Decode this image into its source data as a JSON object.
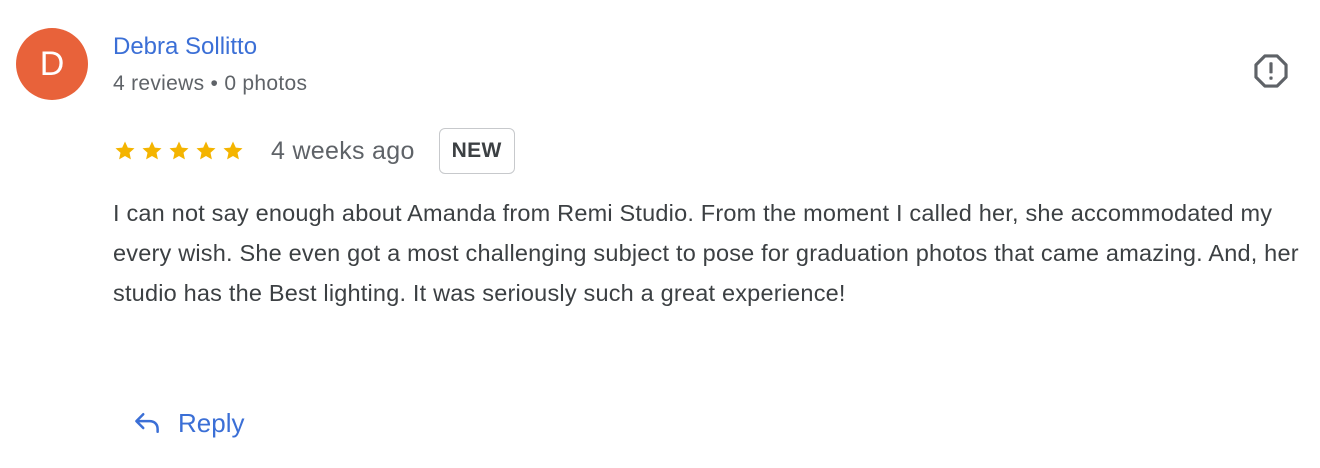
{
  "author": {
    "initial": "D",
    "name": "Debra Sollitto",
    "meta": "4 reviews • 0 photos",
    "avatar_color": "#e8623a"
  },
  "rating": {
    "stars": 5,
    "max": 5,
    "star_color": "#f4b400",
    "time_ago": "4 weeks ago",
    "badge": "NEW"
  },
  "review": {
    "text": "I can not say enough about Amanda from Remi Studio. From the moment I called her, she accommodated my every wish. She even got a most challenging subject to pose for graduation photos that came amazing. And, her studio has the Best lighting. It was seriously such a great experience!"
  },
  "actions": {
    "reply_label": "Reply",
    "reply_icon": "reply-arrow-icon",
    "flag_icon": "report-flag-icon"
  },
  "colors": {
    "link": "#3b6fd6",
    "text": "#3c4043",
    "meta": "#5f6368"
  }
}
